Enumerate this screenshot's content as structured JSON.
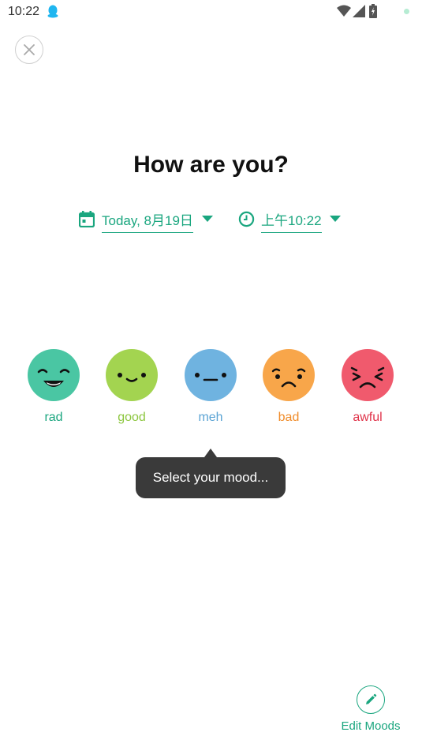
{
  "status_bar": {
    "time": "10:22"
  },
  "title": "How are you?",
  "date_picker": {
    "value": "Today, 8月19日"
  },
  "time_picker": {
    "value": "上午10:22"
  },
  "moods": [
    {
      "label": "rad",
      "icon": "rad-face-icon",
      "color": "#4ac6a3",
      "label_color": "#1aa67f"
    },
    {
      "label": "good",
      "icon": "good-face-icon",
      "color": "#a3d450",
      "label_color": "#8cc63e"
    },
    {
      "label": "meh",
      "icon": "meh-face-icon",
      "color": "#6fb3e0",
      "label_color": "#5aa3d4"
    },
    {
      "label": "bad",
      "icon": "bad-face-icon",
      "color": "#f8a64a",
      "label_color": "#f08c2a"
    },
    {
      "label": "awful",
      "icon": "awful-face-icon",
      "color": "#f05a6d",
      "label_color": "#e0334a"
    }
  ],
  "tooltip": {
    "text": "Select your mood..."
  },
  "edit_moods": {
    "label": "Edit Moods"
  },
  "colors": {
    "accent": "#1aa67f",
    "tooltip_bg": "#3a3a3a"
  }
}
